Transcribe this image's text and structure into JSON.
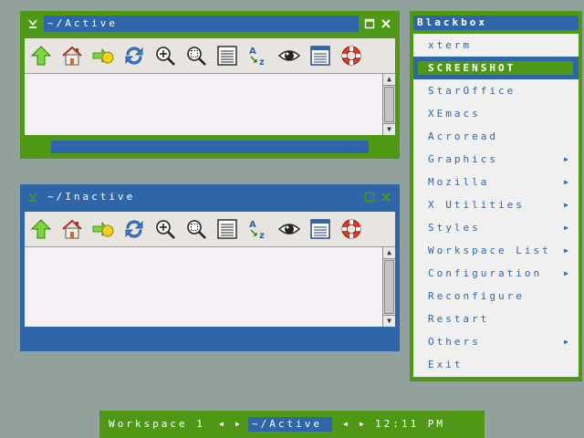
{
  "colors": {
    "active_green": "#4e9816",
    "blue": "#2f66aa",
    "desktop": "#92a19b"
  },
  "active_window": {
    "title": "~/Active",
    "icons": [
      "iconify-icon",
      "maximize-icon",
      "close-icon"
    ]
  },
  "inactive_window": {
    "title": "~/Inactive"
  },
  "toolbar_icons": [
    "up-arrow-icon",
    "home-icon",
    "go-icon",
    "reload-icon",
    "zoom-in-icon",
    "zoom-fit-icon",
    "document-list-icon",
    "sort-az-icon",
    "eye-icon",
    "view-list-icon",
    "help-lifebuoy-icon"
  ],
  "toolbar_glyphs": {
    "sort_a": "A",
    "sort_z": "z"
  },
  "scroll": {
    "up": "▲",
    "down": "▼"
  },
  "menu": {
    "title": "Blackbox",
    "items": [
      {
        "label": "xterm"
      },
      {
        "label": "SCREENSHOT"
      },
      {
        "label": "StarOffice"
      },
      {
        "label": "XEmacs"
      },
      {
        "label": "Acroread"
      },
      {
        "label": "Graphics"
      },
      {
        "label": "Mozilla"
      },
      {
        "label": "X Utilities"
      },
      {
        "label": "Styles"
      },
      {
        "label": "Workspace List"
      },
      {
        "label": "Configuration"
      },
      {
        "label": "Reconfigure"
      },
      {
        "label": "Restart"
      },
      {
        "label": "Others"
      },
      {
        "label": "Exit"
      }
    ],
    "submenu_arrow": "▶"
  },
  "toolbar": {
    "workspace": "Workspace 1",
    "left_arrow": "◀",
    "right_arrow": "▶",
    "window": "~/Active",
    "clock": "12:11 PM"
  }
}
